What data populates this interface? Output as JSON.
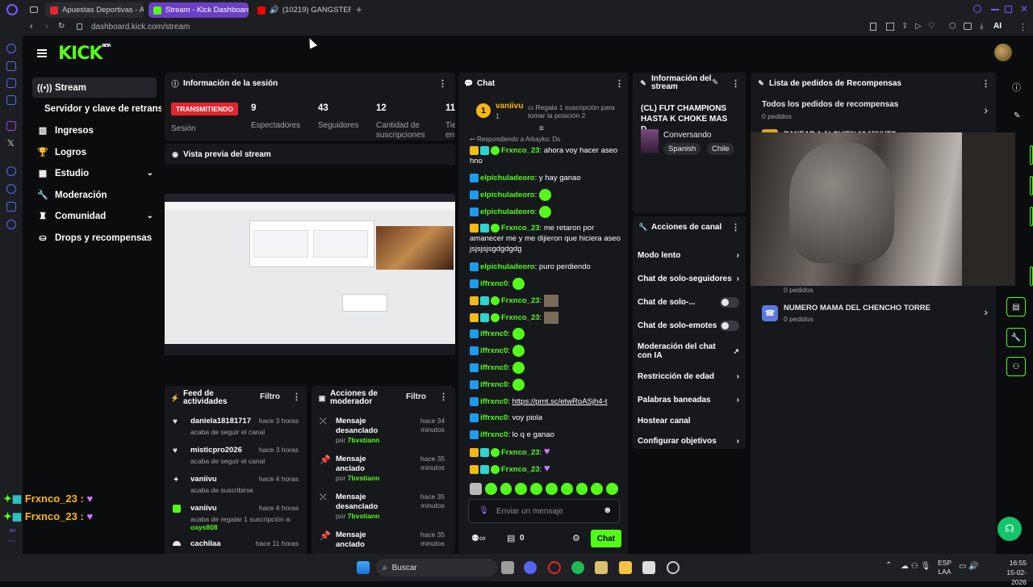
{
  "browser": {
    "tabs": [
      {
        "label": "Apuestas Deportivas - Ap"
      },
      {
        "label": "Stream - Kick Dashboard"
      },
      {
        "label": "(10219) GANGSTER EN"
      }
    ],
    "url": "dashboard.kick.com/stream",
    "ai_label": "AI"
  },
  "kick": {
    "logo": "KICK",
    "logo_sup": "BETA",
    "nav": [
      {
        "label": "Stream"
      },
      {
        "label": "Servidor y clave de retransmisión"
      },
      {
        "label": "Ingresos"
      },
      {
        "label": "Logros"
      },
      {
        "label": "Estudio"
      },
      {
        "label": "Moderación"
      },
      {
        "label": "Comunidad"
      },
      {
        "label": "Drops y recompensas"
      }
    ]
  },
  "session": {
    "title": "Información de la sesión",
    "live_badge": "TRANSMITIENDO",
    "session_label": "Sesión",
    "stats": [
      {
        "value": "9",
        "label": "Espectadores"
      },
      {
        "value": "43",
        "label": "Seguidores"
      },
      {
        "value": "12",
        "label": "Cantidad de suscripciones"
      },
      {
        "value": "11",
        "label": "Tie en"
      }
    ]
  },
  "preview": {
    "title": "Vista previa del stream"
  },
  "feed": {
    "title": "Feed de actividades",
    "filter": "Filtro",
    "items": [
      {
        "user": "daniela18181717",
        "action": "acaba de seguir el canal",
        "time": "hace 3 horas"
      },
      {
        "user": "misticpro2026",
        "action": "acaba de seguir el canal",
        "time": "hace 3 horas"
      },
      {
        "user": "vaniivu",
        "action": "acaba de suscribirse",
        "time": "hace 4 horas"
      },
      {
        "user": "vaniivu",
        "action": "acaba de regalar 1 suscripción a:",
        "extra": "oxys808",
        "time": "hace 4 horas"
      },
      {
        "user": "cachilaa",
        "action": "",
        "time": "hace 11 horas"
      }
    ]
  },
  "modactions": {
    "title": "Acciones de moderador",
    "filter": "Filtro",
    "items": [
      {
        "action": "Mensaje desanclado",
        "by": "por",
        "mod": "7bvstiann",
        "time": "hace 34 minutos"
      },
      {
        "action": "Mensaje anclado",
        "by": "por",
        "mod": "7bvstiann",
        "time": "hace 35 minutos"
      },
      {
        "action": "Mensaje desanclado",
        "by": "por",
        "mod": "7bvstiann",
        "time": "hace 35 minutos"
      },
      {
        "action": "Mensaje anclado",
        "by": "",
        "mod": "",
        "time": "hace 35 minutos"
      }
    ]
  },
  "chat": {
    "title": "Chat",
    "pinned_user": "vaniivu",
    "pinned_count": "1",
    "gift_text": "Regala 1 suscripción para tomar la posición 2",
    "reply_to": "Respondiendo a Arkayko: Ds",
    "messages": [
      {
        "user": "Frxnco_23",
        "text": "ahora voy hacer aseo hno"
      },
      {
        "user": "elpichuladeoro",
        "text": "y hay ganao"
      },
      {
        "user": "elpichuladeoro",
        "text": ""
      },
      {
        "user": "elpichuladeoro",
        "text": ""
      },
      {
        "user": "Frxnco_23",
        "text": "me retaron por amanecer me y me dijieron que hiciera aseo jsjsjsjsgdgdgdg"
      },
      {
        "user": "elpichuladeoro",
        "text": "puro perdiendo"
      },
      {
        "user": "iffrxnc0",
        "text": ""
      },
      {
        "user": "Frxnco_23",
        "text": ""
      },
      {
        "user": "Frxnco_23",
        "text": ""
      },
      {
        "user": "iffrxnc0",
        "text": ""
      },
      {
        "user": "iffrxnc0",
        "text": ""
      },
      {
        "user": "iffrxnc0",
        "text": ""
      },
      {
        "user": "iffrxnc0",
        "text": ""
      },
      {
        "user": "iffrxnc0",
        "text": "https://prnt.sc/etwRoASjh4-t"
      },
      {
        "user": "iffrxnc0",
        "text": "voy piola"
      },
      {
        "user": "iffrxnc0",
        "text": "lo q e ganao"
      },
      {
        "user": "Frxnco_23",
        "text": ""
      },
      {
        "user": "Frxnco_23",
        "text": ""
      }
    ],
    "input_placeholder": "Enviar un mensaje",
    "points": "0",
    "send_label": "Chat"
  },
  "streaminfo": {
    "title": "Información del stream",
    "stream_title": "(CL) FUT CHAMPIONS HASTA K CHOKE MAS D...",
    "category": "Conversando",
    "tags": [
      "Spanish",
      "Chile"
    ]
  },
  "channel": {
    "title": "Acciones de canal",
    "items": [
      {
        "label": "Modo lento",
        "kind": "arrow"
      },
      {
        "label": "Chat de solo-seguidores",
        "kind": "arrow"
      },
      {
        "label": "Chat de solo-...",
        "kind": "toggle"
      },
      {
        "label": "Chat de solo-emotes",
        "kind": "toggle"
      },
      {
        "label": "Moderación del chat con IA",
        "kind": "ext"
      },
      {
        "label": "Restricción de edad",
        "kind": "arrow"
      },
      {
        "label": "Palabras baneadas",
        "kind": "arrow"
      },
      {
        "label": "Hostear canal",
        "kind": "none"
      },
      {
        "label": "Configurar objetivos",
        "kind": "arrow"
      }
    ]
  },
  "rewards": {
    "title": "Lista de pedidos de Recompensas",
    "all_label": "Todos los pedidos de recompensas",
    "all_count": "0 pedidos",
    "partial_label": "RANEAR A ALGUIEN 10 MINUTO",
    "partial_count": "0 pedidos",
    "item_label": "NUMERO MAMA DEL CHENCHO TORRE",
    "item_count": "0 pedidos"
  },
  "overlay": {
    "name1": "Frxnco_23 :",
    "name2": "Frxnco_23 :",
    "ax": "ax"
  },
  "taskbar": {
    "search": "Buscar",
    "lang1": "ESP",
    "lang2": "LAA",
    "time": "16:55",
    "date": "15-02-2026"
  }
}
